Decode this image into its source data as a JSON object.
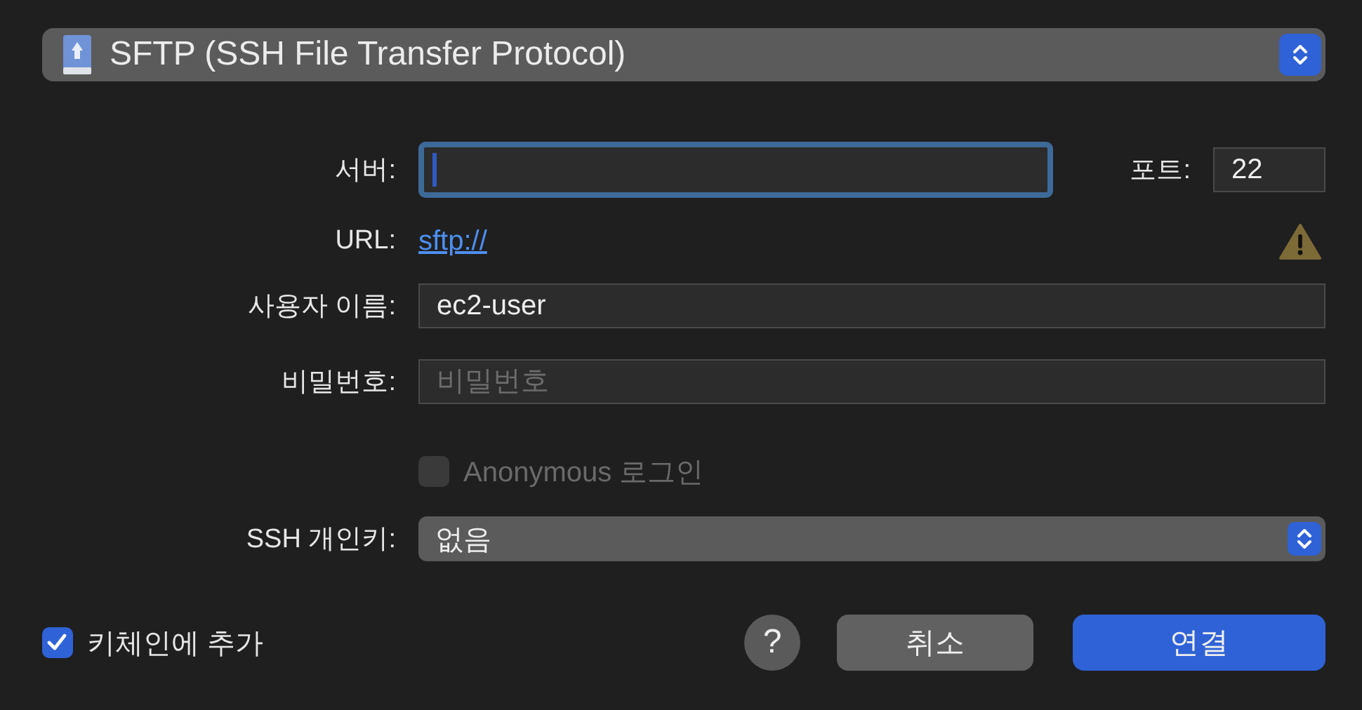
{
  "protocol_popup": {
    "label": "SFTP (SSH File Transfer Protocol)"
  },
  "form": {
    "server": {
      "label": "서버:",
      "focused": true
    },
    "port": {
      "label": "포트:",
      "value": "22"
    },
    "url": {
      "label": "URL:",
      "link": "sftp://",
      "warning": true
    },
    "username": {
      "label": "사용자 이름:",
      "value": "ec2-user"
    },
    "password": {
      "label": "비밀번호:",
      "placeholder": "비밀번호"
    },
    "anonymous": {
      "label": "Anonymous 로그인",
      "checked": false,
      "disabled": true
    },
    "ssh_key": {
      "label": "SSH 개인키:",
      "value": "없음"
    }
  },
  "keychain": {
    "label": "키체인에 추가",
    "checked": true
  },
  "buttons": [
    {
      "label": "?",
      "kind": "help"
    },
    {
      "label": "취소",
      "kind": "normal"
    },
    {
      "label": "연결",
      "kind": "default"
    }
  ]
}
